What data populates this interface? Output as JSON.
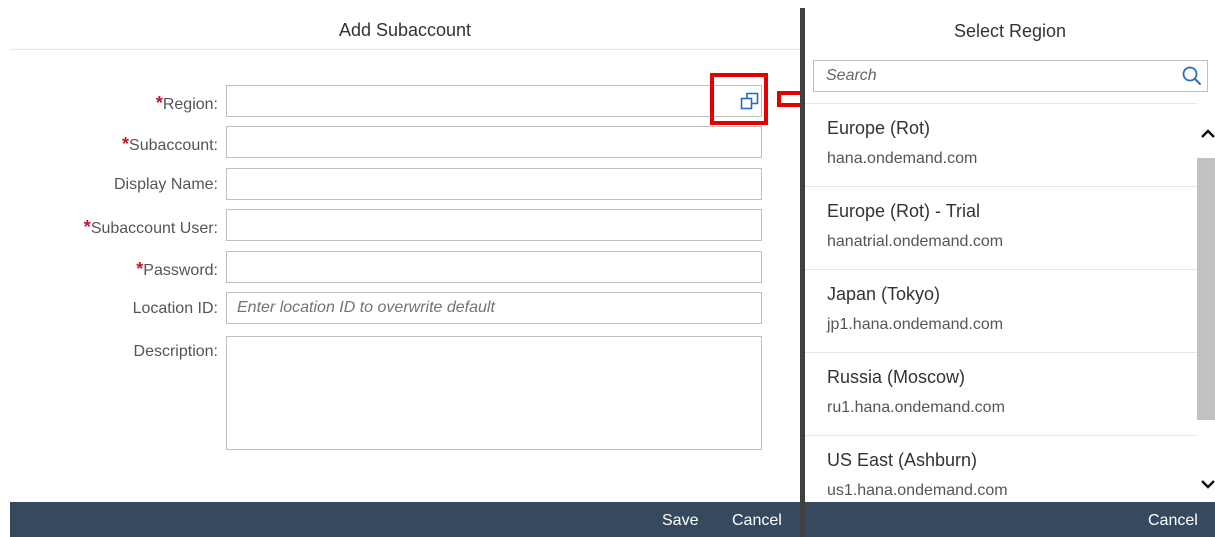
{
  "add_dialog": {
    "title": "Add Subaccount",
    "fields": {
      "region": {
        "required": "*",
        "label": "Region:",
        "value": ""
      },
      "subaccount": {
        "required": "*",
        "label": "Subaccount:",
        "value": ""
      },
      "display_name": {
        "label": "Display Name:",
        "value": ""
      },
      "subaccount_user": {
        "required": "*",
        "label": "Subaccount User:",
        "value": ""
      },
      "password": {
        "required": "*",
        "label": "Password:",
        "value": ""
      },
      "location_id": {
        "label": "Location ID:",
        "value": "",
        "placeholder": "Enter location ID to overwrite default"
      },
      "description": {
        "label": "Description:",
        "value": ""
      }
    },
    "value_help_icon": "value-help-icon",
    "footer": {
      "save_label": "Save",
      "cancel_label": "Cancel"
    }
  },
  "region_dialog": {
    "title": "Select Region",
    "search": {
      "placeholder": "Search",
      "value": "",
      "icon": "search-icon"
    },
    "regions": [
      {
        "name": "Europe (Rot)",
        "host": "hana.ondemand.com"
      },
      {
        "name": "Europe (Rot) - Trial",
        "host": "hanatrial.ondemand.com"
      },
      {
        "name": "Japan (Tokyo)",
        "host": "jp1.hana.ondemand.com"
      },
      {
        "name": "Russia (Moscow)",
        "host": "ru1.hana.ondemand.com"
      },
      {
        "name": "US East (Ashburn)",
        "host": "us1.hana.ondemand.com"
      }
    ],
    "footer": {
      "cancel_label": "Cancel"
    }
  },
  "colors": {
    "footer_bg": "#354a5f",
    "required": "#c0172b",
    "annotation": "#e30000"
  }
}
